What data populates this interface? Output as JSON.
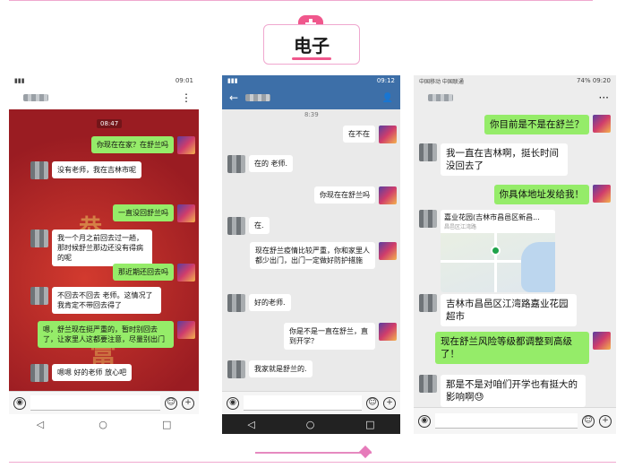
{
  "header": {
    "title": "电子"
  },
  "phone1": {
    "status_right": "09:01",
    "more_icon": "⋮",
    "time": "08:47",
    "messages": [
      {
        "side": "right",
        "text": "你现在在家？在舒兰吗"
      },
      {
        "side": "left",
        "text": "没有老师，我在吉林市呢"
      },
      {
        "side": "right",
        "text": "一直没回舒兰吗"
      },
      {
        "side": "left",
        "text": "我一个月之前回去过一趟，那时候舒兰那边还没有得病的呢"
      },
      {
        "side": "right",
        "text": "那近期还回去吗"
      },
      {
        "side": "left",
        "text": "不回去不回去 老师。这情况了 我肯定不带回去得了"
      },
      {
        "side": "right",
        "text": "嗯，舒兰现在挺严重的，暂时别回去了，让家里人这都要注意，尽量别出门"
      },
      {
        "side": "left",
        "text": "嗯嗯 好的老师 放心吧"
      }
    ],
    "keys": [
      "◁",
      "○",
      "□"
    ]
  },
  "phone2": {
    "status_right": "09:12",
    "back_icon": "←",
    "person_icon": "👤",
    "time": "8:39",
    "messages": [
      {
        "side": "right",
        "text": "在不在"
      },
      {
        "side": "left",
        "text": "在的 老师."
      },
      {
        "side": "right",
        "text": "你现在在舒兰吗"
      },
      {
        "side": "left",
        "text": "在."
      },
      {
        "side": "right",
        "text": "现在舒兰疫情比较严重，你和家里人都少出门，出门一定做好防护措施"
      },
      {
        "side": "left",
        "text": "好的老师."
      },
      {
        "side": "right",
        "text": "你是不是一直在舒兰，直到开学？"
      },
      {
        "side": "left",
        "text": "我家就是舒兰的."
      }
    ],
    "keys": [
      "◁",
      "○",
      "□"
    ]
  },
  "phone3": {
    "status_left": "中国移动 中国联通",
    "status_right": "74% 09:20",
    "more_icon": "···",
    "messages": [
      {
        "side": "right",
        "text": "你目前是不是在舒兰？"
      },
      {
        "side": "left",
        "text": "我一直在吉林啊，挺长时间没回去了"
      },
      {
        "side": "right",
        "text": "你具体地址发给我！"
      },
      {
        "side": "left",
        "text": "吉林市昌邑区江湾路嘉业花园超市"
      },
      {
        "side": "right",
        "text": "现在舒兰风险等级都调整到高级了！"
      },
      {
        "side": "left",
        "text": "那是不是对咱们开学也有挺大的影响啊😓"
      }
    ],
    "map": {
      "title": "嘉业花园(吉林市昌邑区新昌...",
      "subtitle": "昌邑区江湾路"
    }
  },
  "input_icons": {
    "voice": "◉",
    "emoji": "☺",
    "plus": "+"
  }
}
